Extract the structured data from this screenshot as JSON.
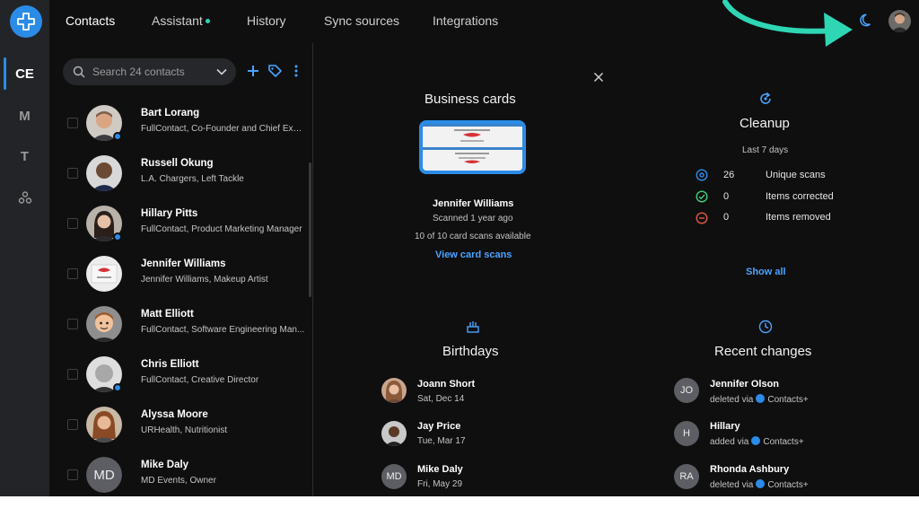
{
  "rail": {
    "items": [
      {
        "label": "CE",
        "active": true
      },
      {
        "label": "M"
      },
      {
        "label": "T"
      }
    ]
  },
  "nav": {
    "tabs": [
      {
        "label": "Contacts",
        "active": true
      },
      {
        "label": "Assistant"
      },
      {
        "label": "History"
      },
      {
        "label": "Sync sources"
      },
      {
        "label": "Integrations"
      }
    ]
  },
  "contacts": {
    "search_placeholder": "Search 24 contacts",
    "rows": [
      {
        "name": "Bart Lorang",
        "sub": "FullContact, Co-Founder and Chief Exe..."
      },
      {
        "name": "Russell Okung",
        "sub": "L.A. Chargers, Left Tackle"
      },
      {
        "name": "Hillary Pitts",
        "sub": "FullContact, Product Marketing Manager"
      },
      {
        "name": "Jennifer Williams",
        "sub": "Jennifer Williams, Makeup Artist"
      },
      {
        "name": "Matt Elliott",
        "sub": "FullContact, Software Engineering Man..."
      },
      {
        "name": "Chris Elliott",
        "sub": "FullContact, Creative Director"
      },
      {
        "name": "Alyssa Moore",
        "sub": "URHealth, Nutritionist"
      },
      {
        "name": "Mike Daly",
        "sub": "MD Events, Owner",
        "initials": "MD"
      }
    ]
  },
  "business_cards": {
    "title": "Business cards",
    "name": "Jennifer Williams",
    "scanned": "Scanned 1 year ago",
    "available": "10 of 10 card scans available",
    "link": "View card scans"
  },
  "cleanup": {
    "title": "Cleanup",
    "period": "Last 7 days",
    "stats": [
      {
        "value": "26",
        "label": "Unique scans",
        "color": "#2b8ce8"
      },
      {
        "value": "0",
        "label": "Items corrected",
        "color": "#3fcf7a"
      },
      {
        "value": "0",
        "label": "Items removed",
        "color": "#e2563f"
      }
    ],
    "link": "Show all"
  },
  "birthdays": {
    "title": "Birthdays",
    "people": [
      {
        "name": "Joann Short",
        "date": "Sat, Dec 14"
      },
      {
        "name": "Jay Price",
        "date": "Tue, Mar 17"
      },
      {
        "name": "Mike Daly",
        "date": "Fri, May 29",
        "initials": "MD"
      }
    ]
  },
  "recent_changes": {
    "title": "Recent changes",
    "people": [
      {
        "initials": "JO",
        "name": "Jennifer Olson",
        "action": "deleted via",
        "source": "Contacts+"
      },
      {
        "initials": "H",
        "name": "Hillary",
        "action": "added via",
        "source": "Contacts+"
      },
      {
        "initials": "RA",
        "name": "Rhonda Ashbury",
        "action": "deleted via",
        "source": "Contacts+"
      }
    ]
  },
  "colors": {
    "accent": "#2b8ce8",
    "arrow": "#2fd6b4",
    "background": "#0f0f10"
  }
}
